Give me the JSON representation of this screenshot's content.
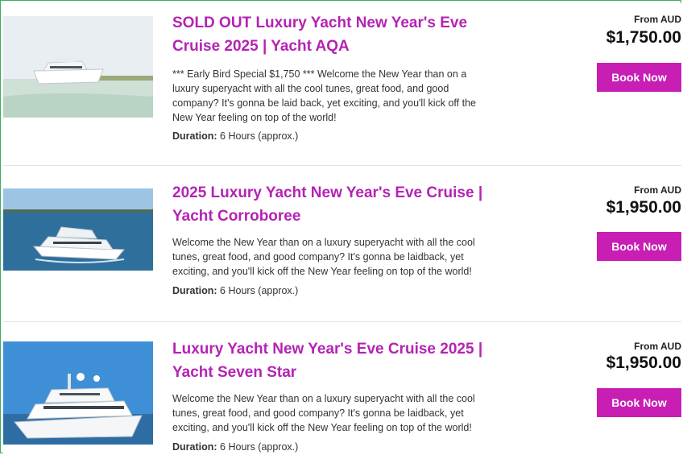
{
  "listings": [
    {
      "title": "SOLD OUT Luxury Yacht New Year's Eve Cruise 2025 | Yacht AQA",
      "description": "*** Early Bird Special $1,750 *** Welcome the New Year than on a luxury superyacht with all the cool tunes, great food, and good company? It's gonna be laid back, yet exciting, and you'll kick off the New Year feeling on top of the world!",
      "duration_label": "Duration:",
      "duration_value": "6 Hours (approx.)",
      "from_label": "From AUD",
      "price": "$1,750.00",
      "button_label": "Book Now",
      "image_icon": "yacht-photo"
    },
    {
      "title": "2025 Luxury Yacht New Year's Eve Cruise | Yacht Corroboree",
      "description": "Welcome the New Year than on a luxury superyacht with all the cool tunes, great food, and good company? It's gonna be laidback, yet exciting, and you'll kick off the New Year feeling on top of the world!",
      "duration_label": "Duration:",
      "duration_value": "6 Hours (approx.)",
      "from_label": "From AUD",
      "price": "$1,950.00",
      "button_label": "Book Now",
      "image_icon": "yacht-photo"
    },
    {
      "title": "Luxury Yacht New Year's Eve Cruise 2025 | Yacht Seven Star",
      "description": "Welcome the New Year than on a luxury superyacht with all the cool tunes, great food, and good company? It's gonna be laidback, yet exciting, and you'll kick off the New Year feeling on top of the world!",
      "duration_label": "Duration:",
      "duration_value": "6 Hours (approx.)",
      "from_label": "From AUD",
      "price": "$1,950.00",
      "button_label": "Book Now",
      "image_icon": "yacht-photo"
    }
  ],
  "colors": {
    "title": "#b423b4",
    "button": "#c81eb4",
    "border": "#3fae5a"
  }
}
